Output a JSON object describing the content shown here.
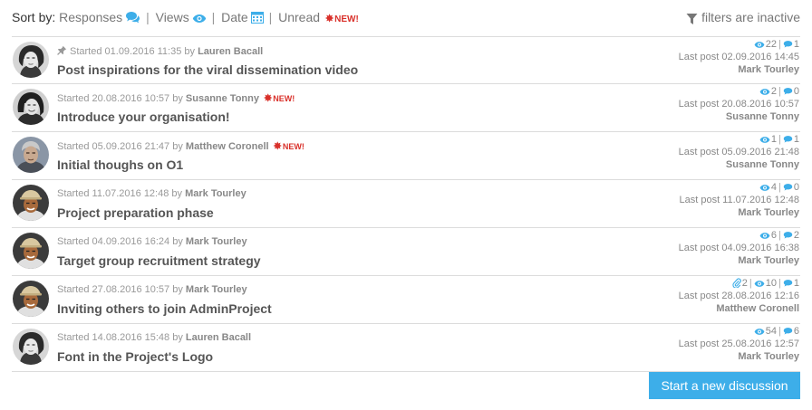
{
  "sortbar": {
    "label": "Sort by:",
    "options": [
      {
        "label": "Responses",
        "icon": "comments-icon"
      },
      {
        "label": "Views",
        "icon": "eye-icon"
      },
      {
        "label": "Date",
        "icon": "calendar-icon"
      },
      {
        "label": "Unread",
        "icon": "new-star-icon",
        "badge": "NEW!"
      }
    ],
    "filters_label": "filters are inactive"
  },
  "colors": {
    "accent": "#3daee9",
    "new_badge": "#d9302a",
    "icon_blue": "#3daee9"
  },
  "threads": [
    {
      "pinned": true,
      "started_prefix": "Started 01.09.2016 11:35 by",
      "author": "Lauren Bacall",
      "new": false,
      "title": "Post inspirations for the viral dissemination video",
      "attachments": null,
      "views": "22",
      "replies": "1",
      "last_post": "Last post 02.09.2016 14:45",
      "last_author": "Mark Tourley",
      "avatar": "lauren"
    },
    {
      "pinned": false,
      "started_prefix": "Started 20.08.2016 10:57 by",
      "author": "Susanne Tonny",
      "new": true,
      "title": "Introduce your organisation!",
      "attachments": null,
      "views": "2",
      "replies": "0",
      "last_post": "Last post 20.08.2016 10:57",
      "last_author": "Susanne Tonny",
      "avatar": "susanne"
    },
    {
      "pinned": false,
      "started_prefix": "Started 05.09.2016 21:47 by",
      "author": "Matthew Coronell",
      "new": true,
      "title": "Initial thoughs on O1",
      "attachments": null,
      "views": "1",
      "replies": "1",
      "last_post": "Last post 05.09.2016 21:48",
      "last_author": "Susanne Tonny",
      "avatar": "matthew"
    },
    {
      "pinned": false,
      "started_prefix": "Started 11.07.2016 12:48 by",
      "author": "Mark Tourley",
      "new": false,
      "title": "Project preparation phase",
      "attachments": null,
      "views": "4",
      "replies": "0",
      "last_post": "Last post 11.07.2016 12:48",
      "last_author": "Mark Tourley",
      "avatar": "mark"
    },
    {
      "pinned": false,
      "started_prefix": "Started 04.09.2016 16:24 by",
      "author": "Mark Tourley",
      "new": false,
      "title": "Target group recruitment strategy",
      "attachments": null,
      "views": "6",
      "replies": "2",
      "last_post": "Last post 04.09.2016 16:38",
      "last_author": "Mark Tourley",
      "avatar": "mark"
    },
    {
      "pinned": false,
      "started_prefix": "Started 27.08.2016 10:57 by",
      "author": "Mark Tourley",
      "new": false,
      "title": "Inviting others to join AdminProject",
      "attachments": "2",
      "views": "10",
      "replies": "1",
      "last_post": "Last post 28.08.2016 12:16",
      "last_author": "Matthew Coronell",
      "avatar": "mark"
    },
    {
      "pinned": false,
      "started_prefix": "Started 14.08.2016 15:48 by",
      "author": "Lauren Bacall",
      "new": false,
      "title": "Font in the Project's Logo",
      "attachments": null,
      "views": "54",
      "replies": "6",
      "last_post": "Last post 25.08.2016 12:57",
      "last_author": "Mark Tourley",
      "avatar": "lauren"
    }
  ],
  "new_badge_text": "NEW!",
  "new_discussion_label": "Start a new discussion"
}
